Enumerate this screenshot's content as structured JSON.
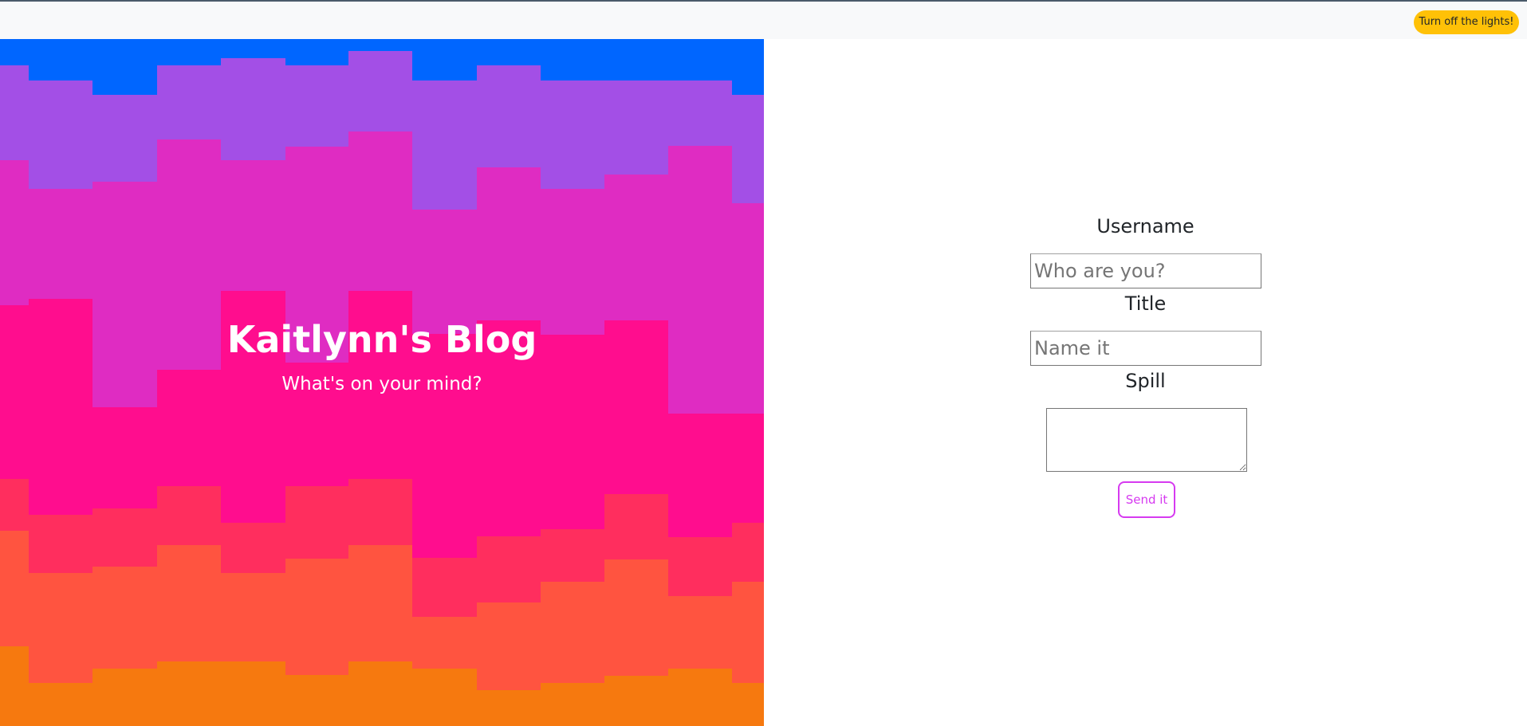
{
  "navbar": {
    "lights_button_label": "Turn off the lights!"
  },
  "hero": {
    "title": "Kaitlynn's Blog",
    "subtitle": "What's on your mind?"
  },
  "form": {
    "username_label": "Username",
    "username_placeholder": "Who are you?",
    "title_label": "Title",
    "title_placeholder": "Name it",
    "spill_label": "Spill",
    "spill_value": "",
    "send_button_label": "Send it"
  },
  "colors": {
    "navbar_bg": "#f8f9fa",
    "lights_button_bg": "#ffc107",
    "hero_layers": [
      "#0066ff",
      "#a34fe6",
      "#df2cc2",
      "#ff0d8e",
      "#ff2e5e",
      "#ff5440",
      "#f6790f"
    ],
    "send_button_accent": "#d63af0"
  }
}
